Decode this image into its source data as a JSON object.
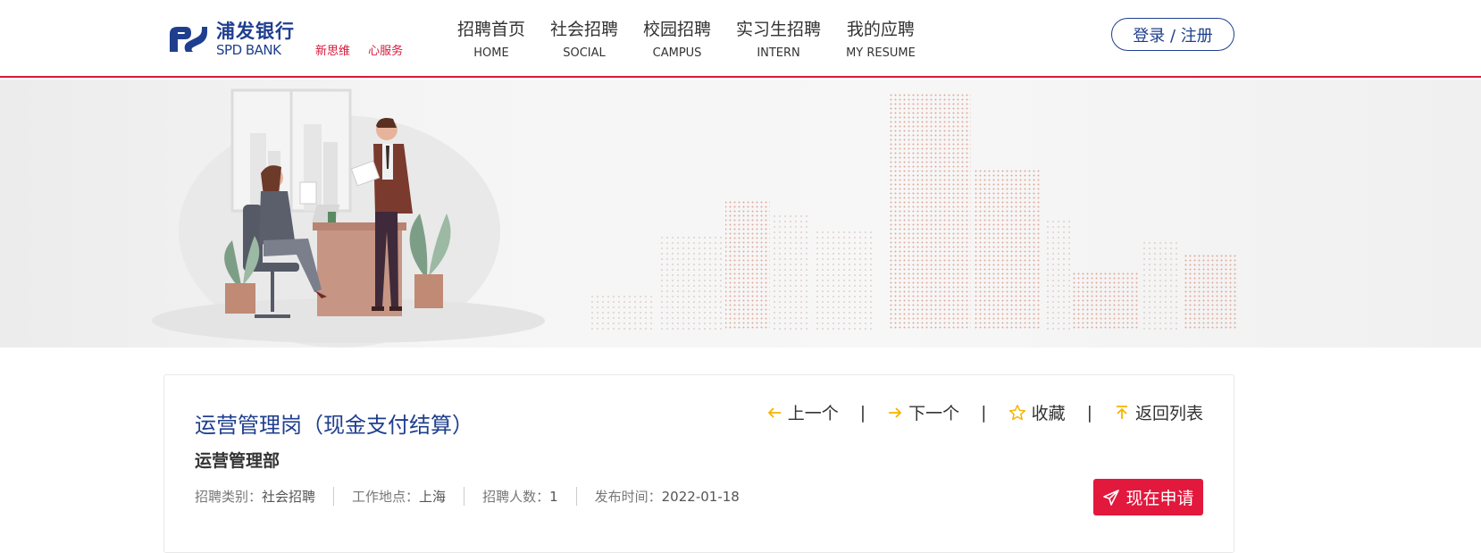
{
  "brand": {
    "name_cn": "浦发银行",
    "name_en": "SPD BANK",
    "slogan": [
      "新思维",
      "心服务"
    ],
    "primary_color": "#1f3f8e",
    "accent_color": "#d7193a"
  },
  "nav": [
    {
      "cn": "招聘首页",
      "en": "HOME"
    },
    {
      "cn": "社会招聘",
      "en": "SOCIAL"
    },
    {
      "cn": "校园招聘",
      "en": "CAMPUS"
    },
    {
      "cn": "实习生招聘",
      "en": "INTERN"
    },
    {
      "cn": "我的应聘",
      "en": "MY RESUME"
    }
  ],
  "auth": {
    "label": "登录 / 注册"
  },
  "job": {
    "title": "运营管理岗（现金支付结算）",
    "department": "运营管理部",
    "meta": [
      {
        "key": "招聘类别：",
        "value": "社会招聘"
      },
      {
        "key": "工作地点：",
        "value": "上海"
      },
      {
        "key": "招聘人数：",
        "value": "1"
      },
      {
        "key": "发布时间：",
        "value": "2022-01-18"
      }
    ]
  },
  "actions": {
    "prev": "上一个",
    "next": "下一个",
    "favorite": "收藏",
    "back": "返回列表",
    "separator": "|"
  },
  "apply": {
    "label": "现在申请"
  },
  "icons": {
    "prev": "arrow-left-icon",
    "next": "arrow-right-icon",
    "favorite": "star-icon",
    "back": "arrow-up-icon",
    "apply": "paper-plane-icon",
    "action_icon_color": "#f5b400"
  }
}
